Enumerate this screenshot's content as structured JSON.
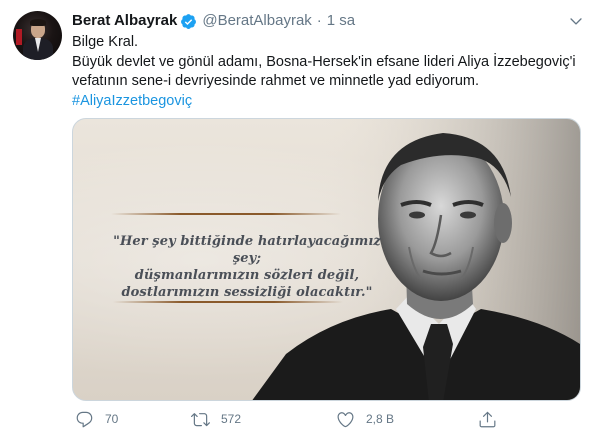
{
  "tweet": {
    "author": {
      "name": "Berat Albayrak",
      "handle": "@BeratAlbayrak",
      "verified": true,
      "avatar_icon": "profile-photo"
    },
    "separator": "·",
    "time": "1 sa",
    "text_lines": [
      "Bilge Kral.",
      "Büyük devlet ve gönül adamı, Bosna-Hersek'in efsane lideri Aliya İzzebegoviç'i vefatının sene-i devriyesinde rahmet ve minnetle yad ediyorum."
    ],
    "hashtag": "#AliyaIzzetbegoviç",
    "media": {
      "quote_lines": [
        "\"Her şey bittiğinde hatırlayacağımız şey;",
        "düşmanlarımızın sözleri değil,",
        "dostlarımızın sessizliği olacaktır.\""
      ]
    },
    "actions": {
      "reply_count": "70",
      "retweet_count": "572",
      "like_count": "2,8 B"
    }
  },
  "colors": {
    "link": "#1b95e0",
    "muted": "#657786",
    "text": "#14171a",
    "verified": "#1da1f2"
  }
}
